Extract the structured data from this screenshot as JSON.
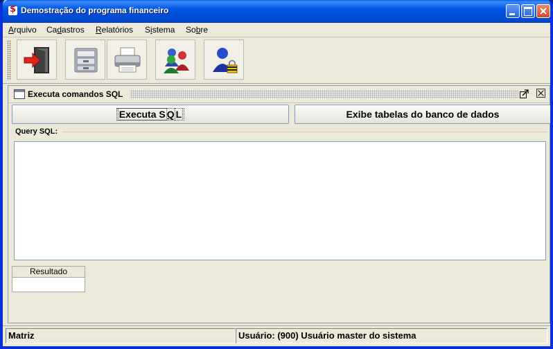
{
  "window": {
    "title": "Demostração do programa financeiro"
  },
  "menubar": {
    "items": [
      {
        "label": "Arquivo",
        "pre": "",
        "u": "A",
        "post": "rquivo"
      },
      {
        "label": "Cadastros",
        "pre": "Ca",
        "u": "d",
        "post": "astros"
      },
      {
        "label": "Relatórios",
        "pre": "",
        "u": "R",
        "post": "elatórios"
      },
      {
        "label": "Sistema",
        "pre": "S",
        "u": "i",
        "post": "stema"
      },
      {
        "label": "Sobre",
        "pre": "So",
        "u": "b",
        "post": "re"
      }
    ]
  },
  "toolbar": {
    "tools": [
      {
        "name": "exit-icon"
      },
      {
        "name": "file-cabinet-icon"
      },
      {
        "name": "printer-icon"
      },
      {
        "name": "users-icon"
      },
      {
        "name": "user-lock-icon"
      }
    ]
  },
  "internal_frame": {
    "title": "Executa comandos SQL",
    "execute_button": "Executa SQL",
    "execute_pre": "Executa S",
    "execute_u": "Q",
    "execute_post": "L",
    "show_tables_button": "Exibe tabelas do banco de dados",
    "query_label": "Query SQL:",
    "query_value": "",
    "result_header": "Resultado"
  },
  "statusbar": {
    "branch": "Matriz",
    "user": "Usuário: (900) Usuário master do sistema"
  },
  "colors": {
    "titlebar": "#0054e3",
    "window_bg": "#ece9d8",
    "border_blue": "#7f9db9"
  }
}
